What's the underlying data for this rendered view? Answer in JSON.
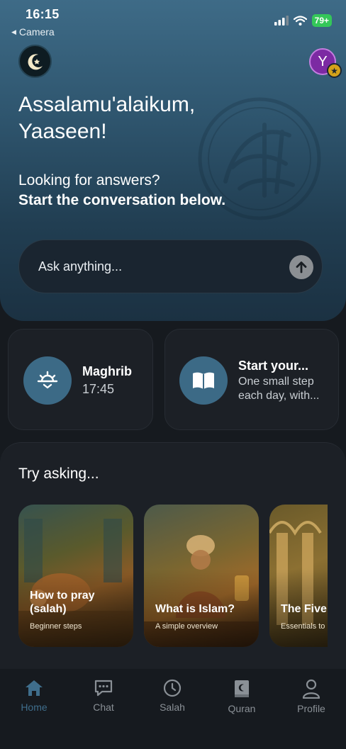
{
  "status_bar": {
    "time": "16:15",
    "back_label": "Camera",
    "battery": "79+"
  },
  "header": {
    "logo_icon": "crescent-star-icon",
    "avatar_letter": "Y",
    "avatar_badge_icon": "star-icon"
  },
  "hero": {
    "greeting_line1": "Assalamu'alaikum,",
    "greeting_line2": "Yaaseen!",
    "subtitle": "Looking for answers?",
    "subtitle_bold": "Start the conversation below.",
    "input_placeholder": "Ask anything..."
  },
  "cards": [
    {
      "icon": "sunset-icon",
      "title": "Maghrib",
      "subtitle": "17:45"
    },
    {
      "icon": "open-book-icon",
      "title": "Start your...",
      "subtitle_line1": "One small step",
      "subtitle_line2": "each day, with..."
    }
  ],
  "try_asking": {
    "title": "Try asking...",
    "items": [
      {
        "title_line1": "How to pray",
        "title_line2": "(salah)",
        "subtitle": "Beginner steps"
      },
      {
        "title_line1": "What is Islam?",
        "title_line2": "",
        "subtitle": "A simple overview"
      },
      {
        "title_line1": "The Five",
        "title_line2": "",
        "subtitle": "Essentials to"
      }
    ]
  },
  "nav": [
    {
      "label": "Home",
      "icon": "home-icon",
      "active": true
    },
    {
      "label": "Chat",
      "icon": "chat-icon",
      "active": false
    },
    {
      "label": "Salah",
      "icon": "clock-icon",
      "active": false
    },
    {
      "label": "Quran",
      "icon": "quran-icon",
      "active": false
    },
    {
      "label": "Profile",
      "icon": "person-icon",
      "active": false
    }
  ],
  "colors": {
    "accent": "#3f6e8c",
    "hero_top": "#3e6b87",
    "background": "#161a1f",
    "card": "#1c2026"
  }
}
